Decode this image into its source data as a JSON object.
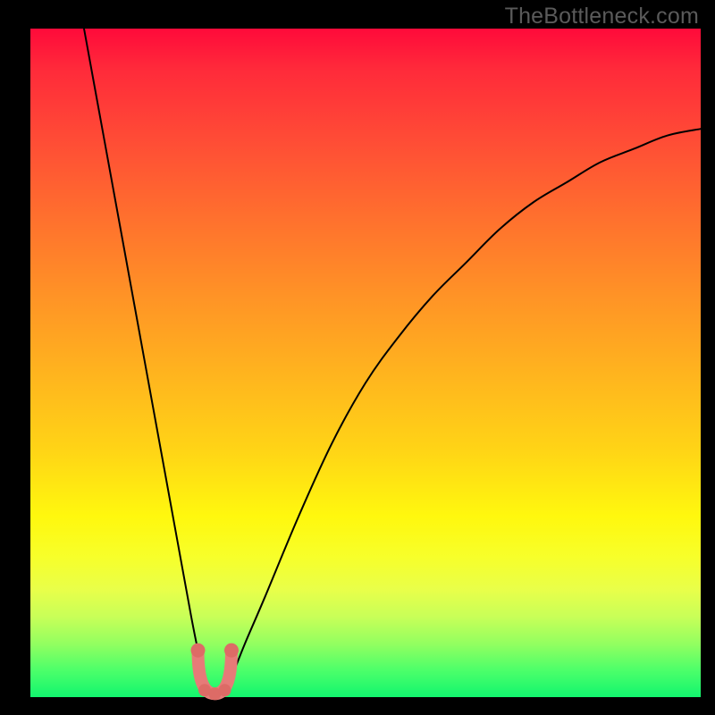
{
  "watermark": "TheBottleneck.com",
  "colors": {
    "background": "#000000",
    "gradient_top": "#ff0a3a",
    "gradient_mid": "#ffd416",
    "gradient_bottom": "#12f56e",
    "curve": "#000000",
    "marker_stroke": "#e67b78",
    "marker_dot": "#dd6b66"
  },
  "chart_data": {
    "type": "line",
    "title": "",
    "xlabel": "",
    "ylabel": "",
    "xlim": [
      0,
      100
    ],
    "ylim": [
      0,
      100
    ],
    "grid": false,
    "legend": null,
    "series": [
      {
        "name": "bottleneck-curve",
        "x": [
          8,
          10,
          12,
          14,
          16,
          18,
          20,
          22,
          24,
          25,
          26,
          27,
          28,
          29,
          30,
          32,
          35,
          40,
          45,
          50,
          55,
          60,
          65,
          70,
          75,
          80,
          85,
          90,
          95,
          100
        ],
        "values": [
          100,
          89,
          78,
          67,
          56,
          45,
          34,
          23,
          12,
          7,
          3,
          1,
          0.5,
          1,
          3,
          8,
          15,
          27,
          38,
          47,
          54,
          60,
          65,
          70,
          74,
          77,
          80,
          82,
          84,
          85
        ]
      }
    ],
    "annotations": [
      {
        "name": "optimal-marker",
        "x_range": [
          25,
          30
        ],
        "value_range": [
          0.5,
          7
        ],
        "shape": "u-arc"
      }
    ]
  }
}
